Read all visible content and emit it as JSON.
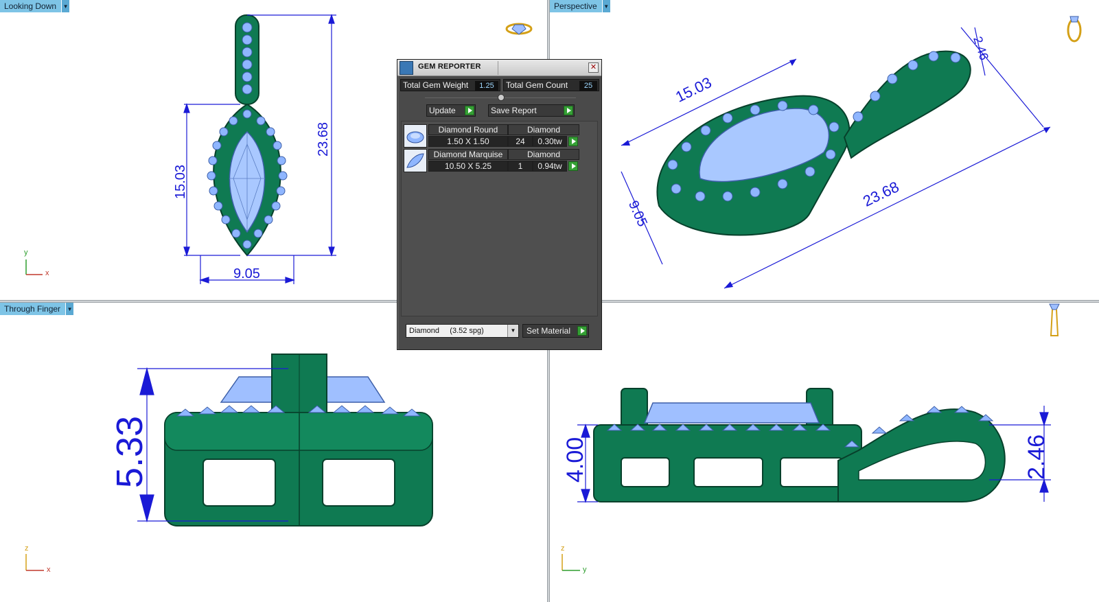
{
  "viewports": {
    "top_left": {
      "label": "Looking Down",
      "dims": [
        "23.68",
        "15.03",
        "9.05"
      ],
      "axes": [
        "y",
        "x"
      ]
    },
    "top_right": {
      "label": "Perspective",
      "dims": [
        "15.03",
        "2.46",
        "23.68",
        "9.05"
      ]
    },
    "bottom_left": {
      "label": "Through Finger",
      "dims": [
        "5.33"
      ],
      "axes": [
        "z",
        "x"
      ]
    },
    "bottom_right": {
      "label": "",
      "dims": [
        "4.00",
        "2.46"
      ],
      "axes": [
        "z",
        "y"
      ]
    }
  },
  "gem_reporter": {
    "title": "GEM REPORTER",
    "close_symbol": "✕",
    "total_weight_label": "Total Gem Weight",
    "total_weight_value": "1.25",
    "total_count_label": "Total Gem Count",
    "total_count_value": "25",
    "update_label": "Update",
    "save_report_label": "Save Report",
    "gems": [
      {
        "name": "Diamond Round",
        "material": "Diamond",
        "size": "1.50 X 1.50",
        "count": "24",
        "weight": "0.30tw"
      },
      {
        "name": "Diamond Marquise",
        "material": "Diamond",
        "size": "10.50 X 5.25",
        "count": "1",
        "weight": "0.94tw"
      }
    ],
    "material_selected": "Diamond     (3.52 spg)",
    "set_material_label": "Set Material"
  },
  "colors": {
    "metal": "#0f7a52",
    "metal_dark": "#07402b",
    "gem": "#8fb6ff",
    "dimension": "#1a1ad6",
    "axis_x": "#c0392b",
    "axis_y": "#2e9e2e",
    "axis_z": "#d4a017"
  },
  "icons": [
    "ring-top-icon",
    "ring-perspective-icon",
    "ring-side-icon"
  ]
}
